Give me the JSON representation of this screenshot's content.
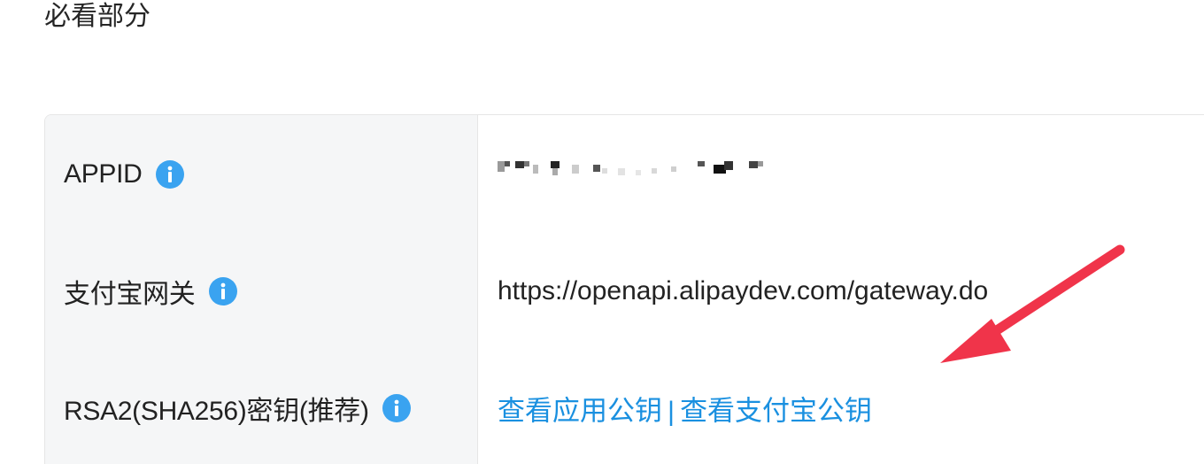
{
  "section": {
    "title": "必看部分"
  },
  "rows": [
    {
      "label": "APPID",
      "value": "",
      "value_masked": true
    },
    {
      "label": "支付宝网关",
      "value": "https://openapi.alipaydev.com/gateway.do"
    },
    {
      "label": "RSA2(SHA256)密钥(推荐)",
      "links": {
        "app_public_key": "查看应用公钥",
        "separator": "|",
        "alipay_public_key": "查看支付宝公钥"
      }
    }
  ],
  "icons": {
    "info": "info-icon",
    "annotation": "red-arrow-annotation"
  },
  "colors": {
    "link": "#1a90e0",
    "info_icon": "#3aa3f0",
    "label_bg": "#f5f6f7",
    "arrow": "#f0344a"
  }
}
